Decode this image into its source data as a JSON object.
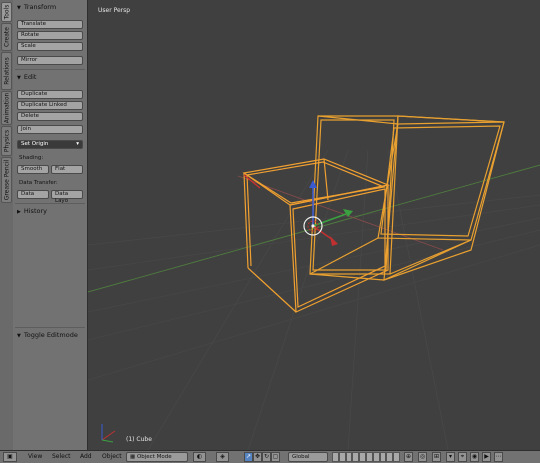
{
  "tabs": [
    "Tools",
    "Create",
    "Relations",
    "Animation",
    "Physics",
    "Grease Pencil"
  ],
  "toolshelf": {
    "transform": {
      "title": "Transform",
      "buttons": [
        "Translate",
        "Rotate",
        "Scale",
        "Mirror"
      ]
    },
    "edit": {
      "title": "Edit",
      "buttons": [
        "Duplicate",
        "Duplicate Linked",
        "Delete",
        "Join"
      ],
      "set_origin": "Set Origin",
      "shading_label": "Shading:",
      "shading_buttons": [
        "Smooth",
        "Flat"
      ],
      "data_transfer_label": "Data Transfer:",
      "data_transfer_buttons": [
        "Data",
        "Data Layo"
      ]
    },
    "history": {
      "title": "History"
    },
    "operator": {
      "title": "Toggle Editmode"
    }
  },
  "viewport": {
    "title": "User Persp",
    "active_object": "(1) Cube",
    "colors": {
      "background": "#404040",
      "grid": "#474747",
      "selection": "#f0a030"
    }
  },
  "header": {
    "menus": [
      "View",
      "Select",
      "Add",
      "Object"
    ],
    "mode": "Object Mode",
    "orientation": "Global"
  }
}
